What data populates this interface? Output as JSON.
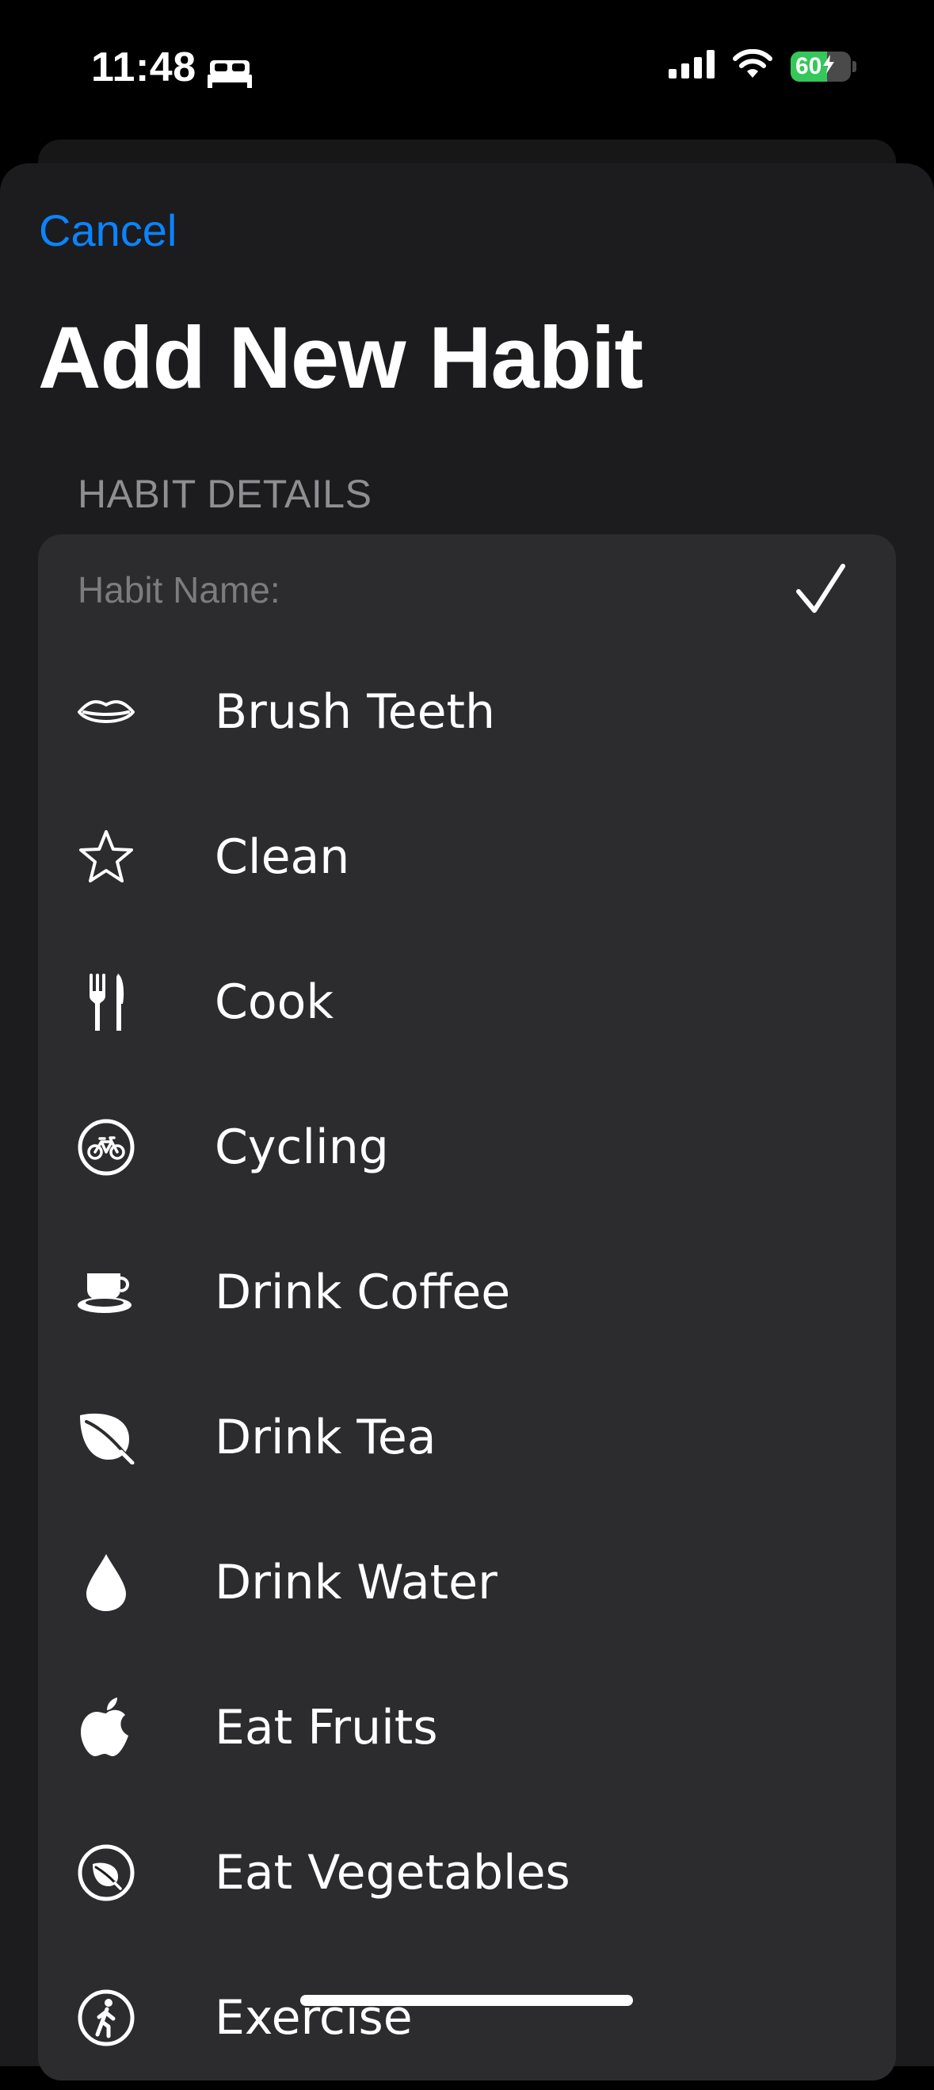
{
  "status_bar": {
    "time": "11:48",
    "focus_icon": "bed-icon",
    "battery_percent": "60",
    "battery_level": 0.6,
    "battery_color": "#34c759"
  },
  "nav": {
    "cancel_label": "Cancel",
    "title": "Add New Habit"
  },
  "form": {
    "section_header": "HABIT DETAILS",
    "habit_name_placeholder": "Habit Name:",
    "habit_name_value": "",
    "confirm_icon": "checkmark-icon"
  },
  "habits": [
    {
      "label": "Brush Teeth",
      "icon": "lips-icon"
    },
    {
      "label": "Clean",
      "icon": "star-icon"
    },
    {
      "label": "Cook",
      "icon": "fork-knife-icon"
    },
    {
      "label": "Cycling",
      "icon": "bicycle-circle-icon"
    },
    {
      "label": "Drink Coffee",
      "icon": "coffee-cup-icon"
    },
    {
      "label": "Drink Tea",
      "icon": "leaf-icon"
    },
    {
      "label": "Drink Water",
      "icon": "water-drop-icon"
    },
    {
      "label": "Eat Fruits",
      "icon": "apple-icon"
    },
    {
      "label": "Eat Vegetables",
      "icon": "leaf-circle-icon"
    },
    {
      "label": "Exercise",
      "icon": "figure-walk-circle-icon"
    }
  ],
  "colors": {
    "accent": "#0a84ff",
    "background": "#000000",
    "sheet": "#1c1c1e",
    "card": "#2c2c2e",
    "secondary_text": "#8e8e93"
  }
}
